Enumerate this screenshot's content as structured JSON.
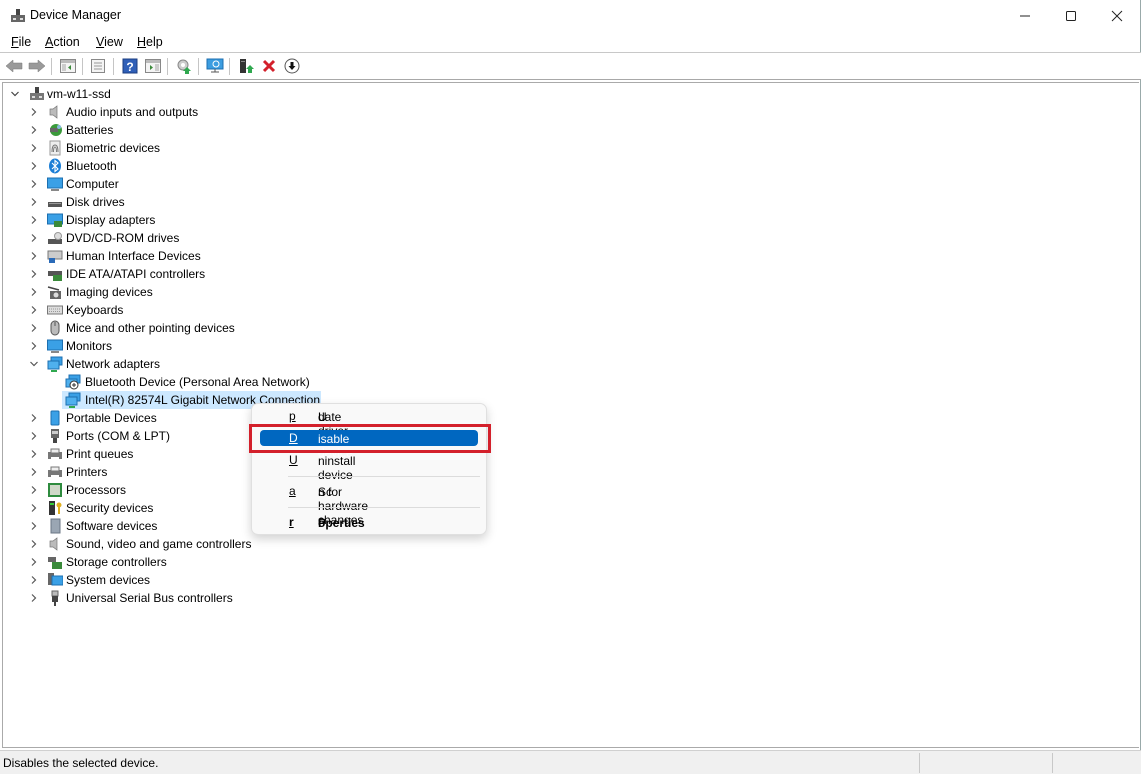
{
  "window": {
    "title": "Device Manager",
    "controls": {
      "minimize": "minimize-icon",
      "maximize": "maximize-icon",
      "close": "close-icon"
    }
  },
  "menubar": {
    "items": [
      {
        "label": "File",
        "accel": "F",
        "rest": "ile"
      },
      {
        "label": "Action",
        "accel": "A",
        "rest": "ction"
      },
      {
        "label": "View",
        "accel": "V",
        "rest": "iew"
      },
      {
        "label": "Help",
        "accel": "H",
        "rest": "elp"
      }
    ]
  },
  "toolbar": {
    "buttons": [
      "back-icon",
      "forward-icon",
      "show-hide-console-tree-icon",
      "properties-icon",
      "help-icon",
      "show-action-pane-icon",
      "update-driver-icon",
      "scan-hardware-icon",
      "enable-device-icon",
      "uninstall-device-icon",
      "disable-device-icon"
    ]
  },
  "tree": {
    "root": {
      "label": "vm-w11-ssd",
      "icon": "computer-root-icon",
      "expanded": true
    },
    "categories": [
      {
        "label": "Audio inputs and outputs",
        "icon": "speaker-icon"
      },
      {
        "label": "Batteries",
        "icon": "battery-icon"
      },
      {
        "label": "Biometric devices",
        "icon": "fingerprint-icon"
      },
      {
        "label": "Bluetooth",
        "icon": "bluetooth-icon"
      },
      {
        "label": "Computer",
        "icon": "monitor-icon"
      },
      {
        "label": "Disk drives",
        "icon": "disk-drive-icon"
      },
      {
        "label": "Display adapters",
        "icon": "display-adapter-icon"
      },
      {
        "label": "DVD/CD-ROM drives",
        "icon": "dvd-drive-icon"
      },
      {
        "label": "Human Interface Devices",
        "icon": "hid-icon"
      },
      {
        "label": "IDE ATA/ATAPI controllers",
        "icon": "ide-controller-icon"
      },
      {
        "label": "Imaging devices",
        "icon": "camera-icon"
      },
      {
        "label": "Keyboards",
        "icon": "keyboard-icon"
      },
      {
        "label": "Mice and other pointing devices",
        "icon": "mouse-icon"
      },
      {
        "label": "Monitors",
        "icon": "monitor-icon"
      },
      {
        "label": "Network adapters",
        "icon": "network-adapter-icon",
        "expanded": true,
        "children": [
          {
            "label": "Bluetooth Device (Personal Area Network)",
            "icon": "bluetooth-network-icon"
          },
          {
            "label": "Intel(R) 82574L Gigabit Network Connection",
            "icon": "network-adapter-icon",
            "selected": true
          }
        ]
      },
      {
        "label": "Portable Devices",
        "icon": "portable-device-icon"
      },
      {
        "label": "Ports (COM & LPT)",
        "icon": "port-icon"
      },
      {
        "label": "Print queues",
        "icon": "printer-icon"
      },
      {
        "label": "Printers",
        "icon": "printer-icon"
      },
      {
        "label": "Processors",
        "icon": "processor-icon"
      },
      {
        "label": "Security devices",
        "icon": "security-key-icon"
      },
      {
        "label": "Software devices",
        "icon": "software-device-icon"
      },
      {
        "label": "Sound, video and game controllers",
        "icon": "speaker-icon"
      },
      {
        "label": "Storage controllers",
        "icon": "storage-controller-icon"
      },
      {
        "label": "System devices",
        "icon": "system-devices-icon"
      },
      {
        "label": "Universal Serial Bus controllers",
        "icon": "usb-icon"
      }
    ]
  },
  "context_menu": {
    "items": [
      {
        "pre": "U",
        "accel": "p",
        "post": "date driver",
        "label": "Update driver"
      },
      {
        "pre": "",
        "accel": "D",
        "post": "isable device",
        "label": "Disable device",
        "highlighted": true
      },
      {
        "pre": "",
        "accel": "U",
        "post": "ninstall device",
        "label": "Uninstall device"
      },
      {
        "pre": "Sc",
        "accel": "a",
        "post": "n for hardware changes",
        "label": "Scan for hardware changes"
      },
      {
        "pre": "P",
        "accel": "r",
        "post": "operties",
        "label": "Properties",
        "bold": true
      }
    ],
    "highlight_color": "#0067c0",
    "annotation_color": "#d3202b"
  },
  "statusbar": {
    "text": "Disables the selected device."
  }
}
